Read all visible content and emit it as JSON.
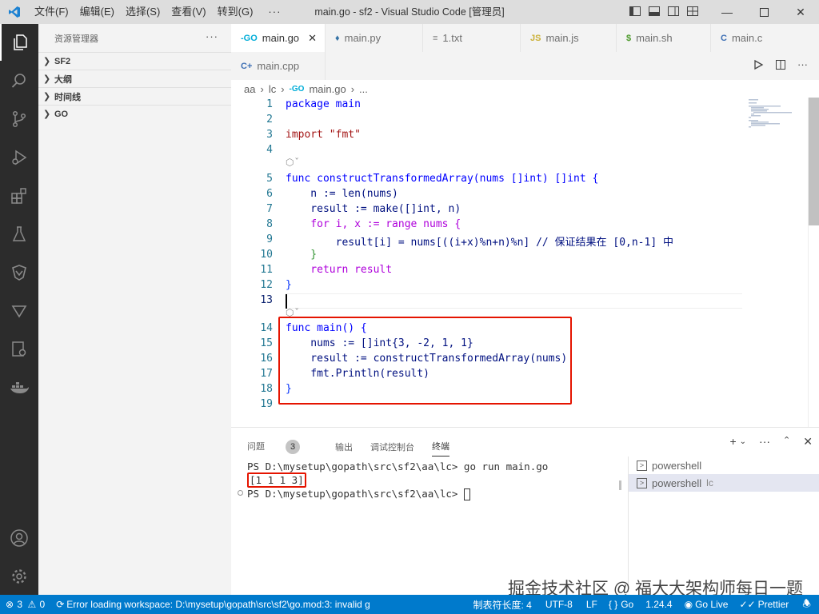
{
  "titlebar": {
    "menus": [
      "文件(F)",
      "编辑(E)",
      "选择(S)",
      "查看(V)",
      "转到(G)"
    ],
    "more": "···",
    "title": "main.go - sf2 - Visual Studio Code [管理员]"
  },
  "sidebar": {
    "header": "资源管理器",
    "more": "···",
    "sections": [
      "SF2",
      "大纲",
      "时间线",
      "GO"
    ]
  },
  "tabs": [
    {
      "label": "main.go",
      "icon": "-GO",
      "active": true
    },
    {
      "label": "main.py",
      "icon": "py"
    },
    {
      "label": "1.txt",
      "icon": "≡"
    },
    {
      "label": "main.js",
      "icon": "JS"
    },
    {
      "label": "main.sh",
      "icon": "$"
    },
    {
      "label": "main.c",
      "icon": "C"
    },
    {
      "label": "main.cpp",
      "icon": "C+"
    }
  ],
  "breadcrumb": [
    "aa",
    "lc",
    "main.go",
    "..."
  ],
  "code": {
    "line_numbers": [
      "1",
      "2",
      "3",
      "4",
      "5",
      "6",
      "7",
      "8",
      "9",
      "10",
      "11",
      "12",
      "13",
      "14",
      "15",
      "16",
      "17",
      "18",
      "19"
    ],
    "lines": {
      "l1": "package main",
      "l3": "import \"fmt\"",
      "l5": "func constructTransformedArray(nums []int) []int {",
      "l6": "    n := len(nums)",
      "l7": "    result := make([]int, n)",
      "l8": "    for i, x := range nums {",
      "l9": "        result[i] = nums[((i+x)%n+n)%n] // 保证结果在 [0,n-1] 中",
      "l10": "    }",
      "l11": "    return result",
      "l12": "}",
      "l14": "func main() {",
      "l15": "    nums := []int{3, -2, 1, 1}",
      "l16": "    result := constructTransformedArray(nums)",
      "l17": "    fmt.Println(result)",
      "l18": "}"
    }
  },
  "panel": {
    "tabs": {
      "problems": "问题",
      "problems_count": "3",
      "output": "输出",
      "debug": "调试控制台",
      "terminal": "终端"
    },
    "terminal_lines": {
      "t1": "PS D:\\mysetup\\gopath\\src\\sf2\\aa\\lc> go run main.go",
      "t2": "[1 1 1 3]",
      "t3": "PS D:\\mysetup\\gopath\\src\\sf2\\aa\\lc> "
    },
    "terminals": [
      "powershell",
      "powershell"
    ],
    "terminal_suffix": "lc"
  },
  "statusbar": {
    "errors": "3",
    "warnings": "0",
    "message": "Error loading workspace: D:\\mysetup\\gopath\\src\\sf2\\go.mod:3: invalid g",
    "tab_size": "制表符长度: 4",
    "encoding": "UTF-8",
    "eol": "LF",
    "language": "Go",
    "go_version": "1.24.4",
    "go_live": "Go Live",
    "prettier": "Prettier"
  },
  "watermark": "掘金技术社区 @ 福大大架构师每日一题",
  "colors": {
    "accent": "#007acc",
    "highlight": "#e51400",
    "activity": "#2c2c2c"
  }
}
